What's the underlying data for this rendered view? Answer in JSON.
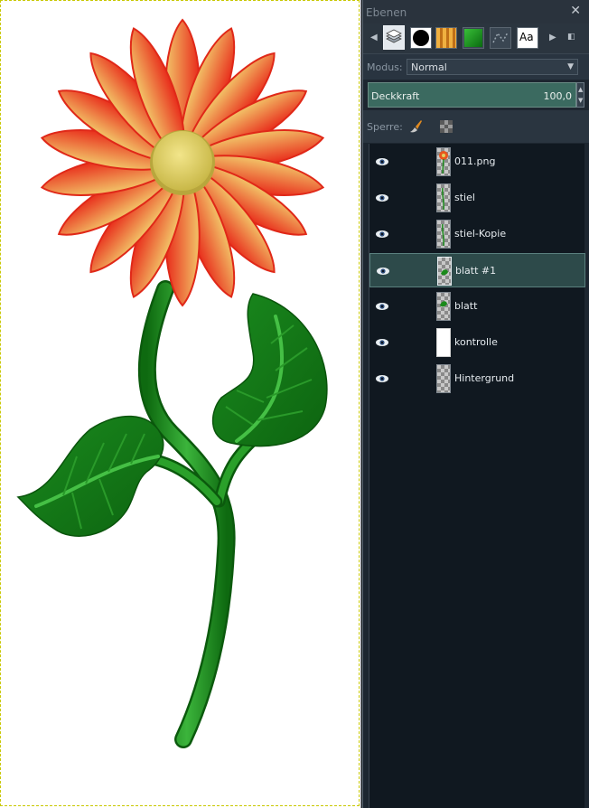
{
  "panel": {
    "title": "Ebenen",
    "tabs": [
      {
        "name": "layers-tab-icon"
      },
      {
        "name": "brush-tab-icon"
      },
      {
        "name": "pattern-tab-icon"
      },
      {
        "name": "gradient-tab-icon"
      },
      {
        "name": "paths-tab-icon"
      },
      {
        "name": "font-tab-icon",
        "label": "Aa"
      }
    ],
    "mode_label": "Modus:",
    "mode_value": "Normal",
    "opacity_label": "Deckkraft",
    "opacity_value": "100,0",
    "lock_label": "Sperre:"
  },
  "layers": [
    {
      "name": "011.png",
      "thumb": "flower",
      "visible": true
    },
    {
      "name": "stiel",
      "thumb": "stem",
      "visible": true
    },
    {
      "name": "stiel-Kopie",
      "thumb": "stem",
      "visible": true
    },
    {
      "name": "blatt #1",
      "thumb": "leaf",
      "visible": true,
      "selected": true
    },
    {
      "name": "blatt",
      "thumb": "leaf",
      "visible": true
    },
    {
      "name": "kontrolle",
      "thumb": "white",
      "visible": true
    },
    {
      "name": "Hintergrund",
      "thumb": "checker",
      "visible": true
    }
  ],
  "colors": {
    "petal_outer": "#e82a1a",
    "petal_inner": "#f0c060",
    "center": "#dcd06a",
    "leaf_dark": "#0e6b12",
    "leaf_light": "#3aa83a",
    "stem": "#1c8a1c",
    "selected_row": "#2d4a4a",
    "opacity_bar": "#3b6a60"
  }
}
